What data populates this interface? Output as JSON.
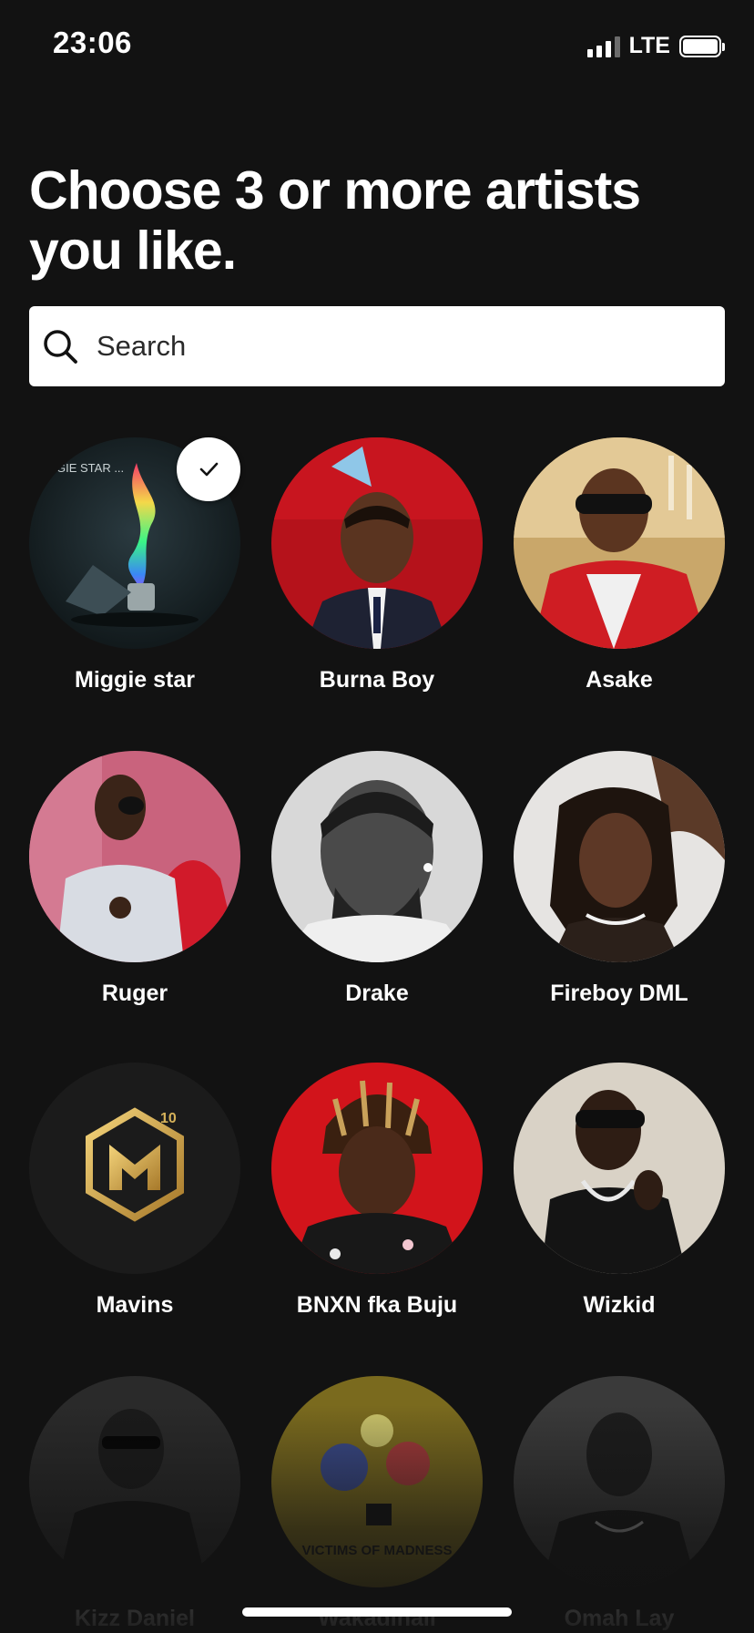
{
  "status_bar": {
    "time": "23:06",
    "network": "LTE"
  },
  "header": {
    "title": "Choose 3 or more artists you like."
  },
  "search": {
    "placeholder": "Search"
  },
  "artists": [
    {
      "name": "Miggie star",
      "selected": true,
      "album_text": "GIE STAR ...",
      "icon": "lighter-flame-artwork"
    },
    {
      "name": "Burna Boy",
      "selected": false,
      "icon": "artist-photo"
    },
    {
      "name": "Asake",
      "selected": false,
      "icon": "artist-photo"
    },
    {
      "name": "Ruger",
      "selected": false,
      "icon": "artist-photo"
    },
    {
      "name": "Drake",
      "selected": false,
      "icon": "artist-photo"
    },
    {
      "name": "Fireboy DML",
      "selected": false,
      "icon": "artist-photo"
    },
    {
      "name": "Mavins",
      "selected": false,
      "icon": "mavins-logo",
      "logo_badge": "10"
    },
    {
      "name": "BNXN fka Buju",
      "selected": false,
      "icon": "artist-photo"
    },
    {
      "name": "Wizkid",
      "selected": false,
      "icon": "artist-photo"
    },
    {
      "name": "Kizz Daniel",
      "selected": false,
      "icon": "artist-photo"
    },
    {
      "name": "Wakadinali",
      "selected": false,
      "icon": "album-artwork",
      "album_text": "VICTIMS OF MADNESS"
    },
    {
      "name": "Omah Lay",
      "selected": false,
      "icon": "artist-photo"
    }
  ],
  "colors": {
    "background": "#121212",
    "text": "#ffffff",
    "search_bg": "#ffffff"
  }
}
